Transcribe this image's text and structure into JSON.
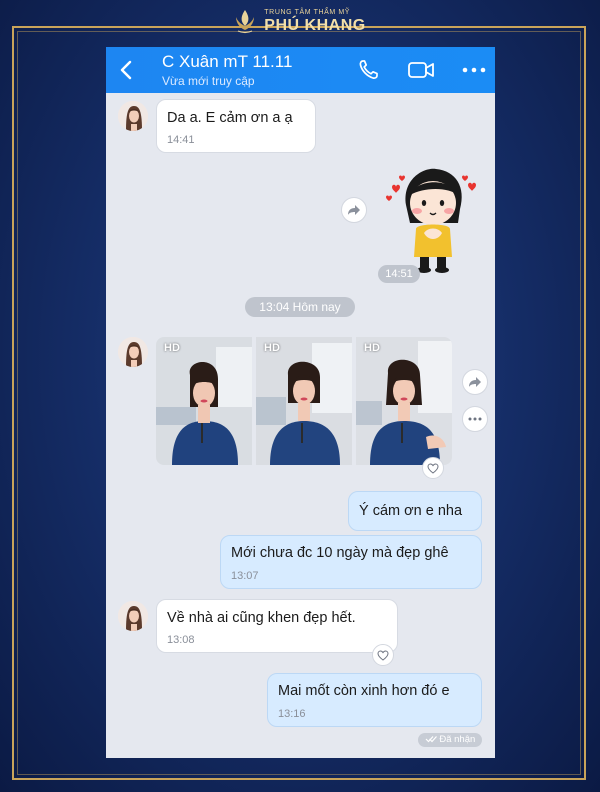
{
  "brand": {
    "subtitle": "TRUNG TÂM THẨM MỸ",
    "name": "PHÚ KHANG"
  },
  "header": {
    "contact_name": "C Xuân mT 11.11",
    "status": "Vừa mới truy cập",
    "icons": [
      "back-chevron-icon",
      "phone-icon",
      "video-call-icon",
      "more-options-icon"
    ]
  },
  "messages": {
    "m1": {
      "text": "Da a. E cảm ơn a ạ",
      "time": "14:41"
    },
    "sticker_time": "14:51",
    "date_separator": "13:04 Hôm nay",
    "photos": [
      {
        "tag": "HD"
      },
      {
        "tag": "HD"
      },
      {
        "tag": "HD"
      }
    ],
    "m2": {
      "text": "Ý cám ơn e nha"
    },
    "m3": {
      "text": "Mới chưa đc 10 ngày mà đẹp ghê",
      "time": "13:07"
    },
    "m4": {
      "text": "Về nhà ai cũng khen đẹp hết.",
      "time": "13:08"
    },
    "m5": {
      "text": "Mai mốt còn xinh hơn đó e",
      "time": "13:16"
    },
    "received": "Đã nhận"
  },
  "colors": {
    "header_blue": "#1d86f2",
    "chat_background": "#e5e8ef",
    "outgoing_bubble": "#d7ebff",
    "incoming_bubble": "#ffffff",
    "gold_accent": "#c9a45a",
    "page_navy": "#142b63"
  }
}
